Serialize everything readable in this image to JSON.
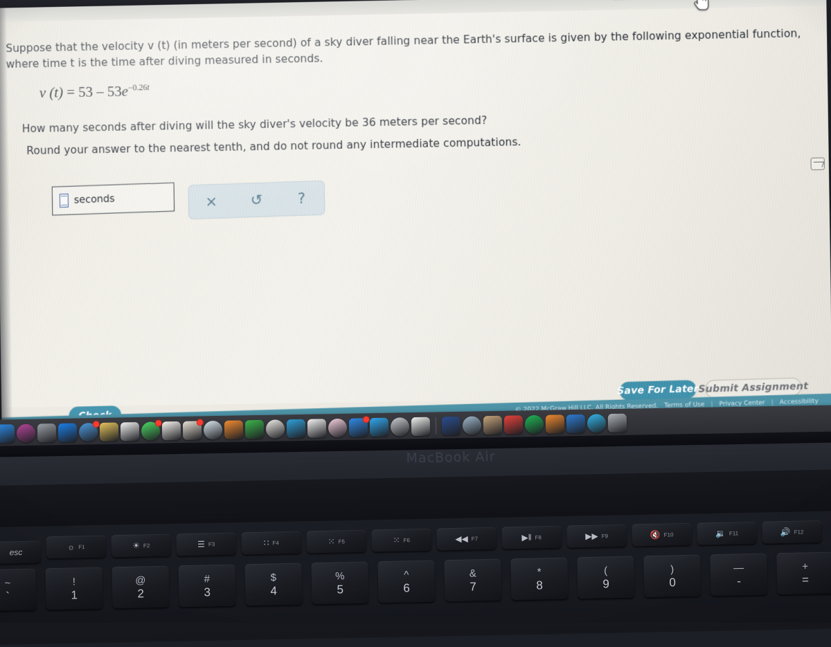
{
  "browser": {
    "tabs": [
      {
        "name": "tab-1",
        "state": "inactive"
      },
      {
        "name": "tab-2",
        "state": "active"
      },
      {
        "name": "tab-3",
        "state": "inactive"
      },
      {
        "name": "tab-4",
        "state": "green"
      }
    ],
    "cursor": "pointing-hand-cursor"
  },
  "question": {
    "stem": "Suppose that the velocity v (t) (in meters per second) of a sky diver falling near the Earth's surface is given by the following exponential function, where time t is the time after diving measured in seconds.",
    "equation": {
      "lhs": "v (t)",
      "equals": "=",
      "term1": "53",
      "minus": "–",
      "term2": "53",
      "base": "e",
      "exponent_sign": "−",
      "exponent_coefficient": "0.26",
      "exponent_variable": "t",
      "plain": "v(t) = 53 – 53e^(−0.26t)"
    },
    "ask": "How many seconds after diving will the sky diver's velocity be 36 meters per second?",
    "rounding": "Round your answer to the nearest tenth, and do not round any intermediate computations."
  },
  "answer": {
    "value": "",
    "placeholder": "",
    "unit": "seconds"
  },
  "toolbar": {
    "clear_icon": "×",
    "undo_icon": "↺",
    "help_icon": "?"
  },
  "side": {
    "icon": "graph-icon"
  },
  "actions": {
    "check": "Check",
    "save_for_later": "Save For Later",
    "submit_assignment": "Submit Assignment"
  },
  "footer": {
    "copyright": "© 2022 McGraw Hill LLC. All Rights Reserved.",
    "links": [
      "Terms of Use",
      "Privacy Center",
      "Accessibility"
    ],
    "separator": "|"
  },
  "laptop": {
    "model_label": "MacBook Air"
  },
  "keyboard": {
    "function_row": [
      {
        "label": "esc",
        "glyph": "",
        "fn": ""
      },
      {
        "label": "",
        "glyph": "☼",
        "fn": "F1"
      },
      {
        "label": "",
        "glyph": "☀",
        "fn": "F2"
      },
      {
        "label": "",
        "glyph": "☰",
        "fn": "F3"
      },
      {
        "label": "",
        "glyph": "∷",
        "fn": "F4"
      },
      {
        "label": "",
        "glyph": "⁙",
        "fn": "F5"
      },
      {
        "label": "",
        "glyph": "⁙",
        "fn": "F6"
      },
      {
        "label": "",
        "glyph": "◀◀",
        "fn": "F7"
      },
      {
        "label": "",
        "glyph": "▶‖",
        "fn": "F8"
      },
      {
        "label": "",
        "glyph": "▶▶",
        "fn": "F9"
      },
      {
        "label": "",
        "glyph": "🔇",
        "fn": "F10"
      },
      {
        "label": "",
        "glyph": "🔉",
        "fn": "F11"
      },
      {
        "label": "",
        "glyph": "🔊",
        "fn": "F12"
      }
    ],
    "number_row": [
      {
        "up": "~",
        "down": "`"
      },
      {
        "up": "!",
        "down": "1"
      },
      {
        "up": "@",
        "down": "2"
      },
      {
        "up": "#",
        "down": "3"
      },
      {
        "up": "$",
        "down": "4"
      },
      {
        "up": "%",
        "down": "5"
      },
      {
        "up": "^",
        "down": "6"
      },
      {
        "up": "&",
        "down": "7"
      },
      {
        "up": "*",
        "down": "8"
      },
      {
        "up": "(",
        "down": "9"
      },
      {
        "up": ")",
        "down": "0"
      },
      {
        "up": "—",
        "down": "-"
      },
      {
        "up": "+",
        "down": "="
      }
    ]
  },
  "dock": {
    "icons": [
      {
        "name": "finder-icon",
        "color": "#2b8ae5"
      },
      {
        "name": "siri-icon",
        "color": "#b6459a"
      },
      {
        "name": "system-prefs-icon",
        "color": "#9aa0a6"
      },
      {
        "name": "safari-icon",
        "color": "#1a7ee6"
      },
      {
        "name": "mail-icon",
        "color": "#4c9ade",
        "badge": true
      },
      {
        "name": "notes-icon",
        "color": "#e6c35c"
      },
      {
        "name": "calendar-icon",
        "color": "#f2f2f2"
      },
      {
        "name": "messages-icon",
        "color": "#4cd964",
        "badge": true
      },
      {
        "name": "reminders-icon",
        "color": "#f5f3ee"
      },
      {
        "name": "contacts-icon",
        "color": "#e8e2d4",
        "badge": true
      },
      {
        "name": "maps-icon",
        "color": "#dbe7ef"
      },
      {
        "name": "pages-icon",
        "color": "#f28b30"
      },
      {
        "name": "numbers-icon",
        "color": "#3ab54a"
      },
      {
        "name": "photos-icon",
        "color": "#f0ede8"
      },
      {
        "name": "keynote-icon",
        "color": "#2e9fd8"
      },
      {
        "name": "no-entry-icon",
        "color": "#f2f2f2"
      },
      {
        "name": "itunes-icon",
        "color": "#f5d1e0"
      },
      {
        "name": "app-store-icon",
        "color": "#2e8ae6",
        "badge": true
      },
      {
        "name": "illustrator-icon",
        "color": "#2fa8ef"
      },
      {
        "name": "preview-icon",
        "color": "#c9ccd1"
      },
      {
        "name": "textedit-icon",
        "color": "#f0f0ef"
      },
      {
        "name": "zoom-icon",
        "color": "#2a4d8f"
      },
      {
        "name": "screenshot-icon",
        "color": "#9fb8cc"
      },
      {
        "name": "word-icon",
        "color": "#c7a47a"
      },
      {
        "name": "chrome-icon",
        "color": "#e8413a"
      },
      {
        "name": "spotify-icon",
        "color": "#1db954"
      },
      {
        "name": "books-icon",
        "color": "#f08a2e"
      },
      {
        "name": "edge-icon",
        "color": "#2b7cd3"
      },
      {
        "name": "skype-icon",
        "color": "#31b7ed"
      },
      {
        "name": "trash-icon",
        "color": "#aeb3b9"
      }
    ]
  }
}
